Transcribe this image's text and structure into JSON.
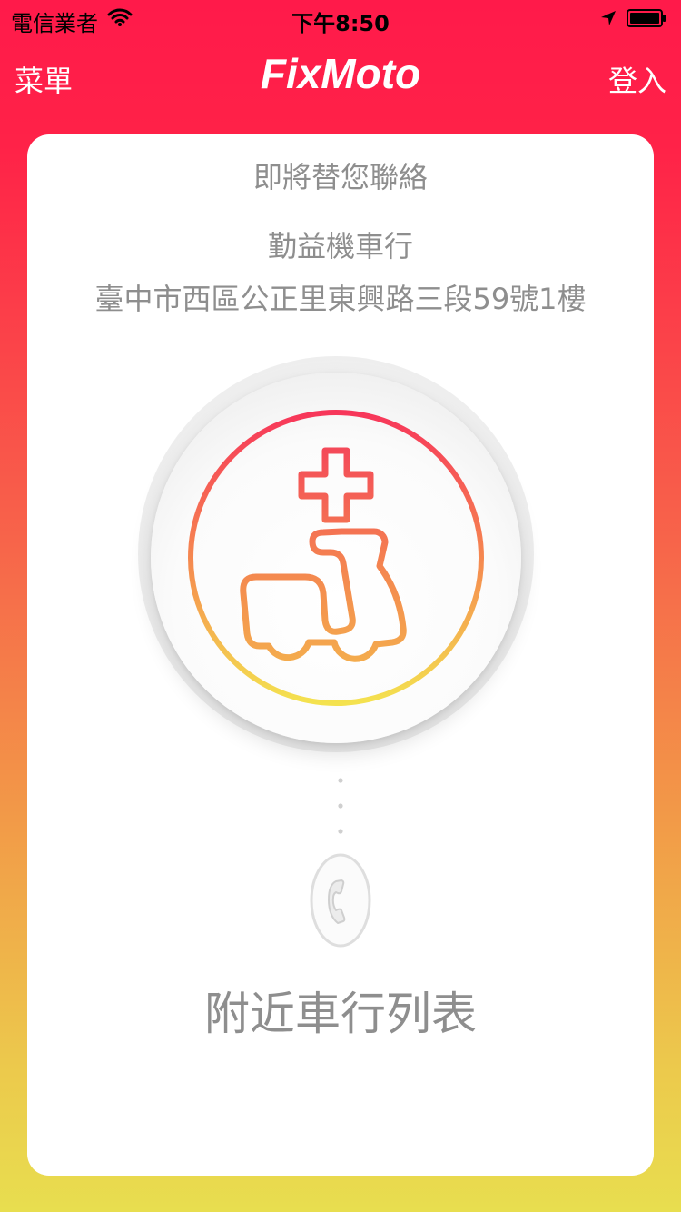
{
  "status_bar": {
    "carrier": "電信業者",
    "time": "下午8:50",
    "icons": [
      "wifi-icon",
      "location-arrow-icon",
      "battery-icon"
    ]
  },
  "nav": {
    "menu_label": "菜單",
    "title": "FixMoto",
    "login_label": "登入"
  },
  "card": {
    "heading": "即將替您聯絡",
    "shop_name": "勤益機車行",
    "shop_address": "臺中市西區公正里東興路三段59號1樓",
    "center_icon": "scooter-repair-icon",
    "connector_icon": "dotted-connector",
    "call_icon": "phone-icon",
    "list_label": "附近車行列表"
  },
  "colors": {
    "gradient_top": "#ff1a4a",
    "gradient_bottom": "#e8de4f",
    "icon_gradient_top": "#f7365a",
    "icon_gradient_bottom": "#f4e24f",
    "text_gray": "#8e8e8e"
  }
}
